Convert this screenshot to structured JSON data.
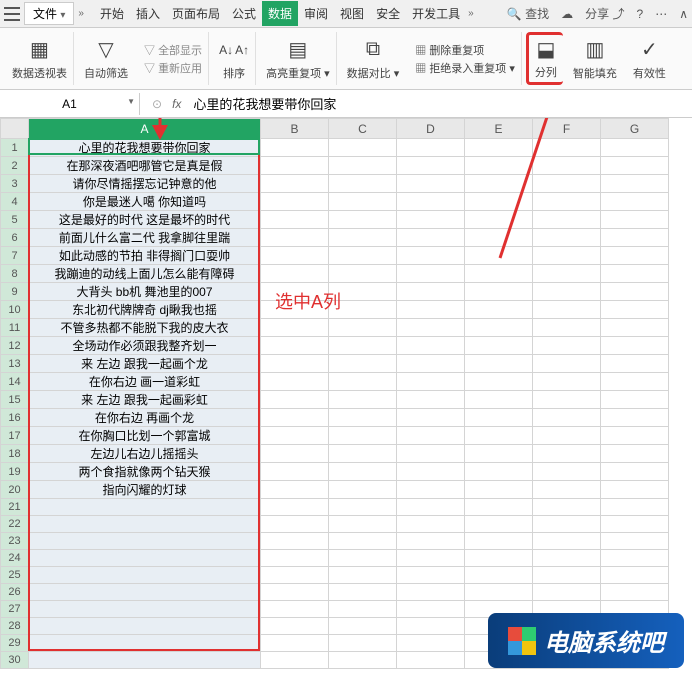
{
  "menubar": {
    "file": "文件",
    "tabs": [
      "开始",
      "插入",
      "页面布局",
      "公式",
      "数据",
      "审阅",
      "视图",
      "安全",
      "开发工具"
    ],
    "active_tab_index": 4,
    "search": "查找",
    "share": "分享"
  },
  "ribbon": {
    "pivot": "数据透视表",
    "filter": "自动筛选",
    "show_all": "全部显示",
    "reapply": "重新应用",
    "sort": "排序",
    "highlight": "高亮重复项",
    "compare": "数据对比",
    "remove_dup": "删除重复项",
    "reject_dup": "拒绝录入重复项",
    "split_col": "分列",
    "smart_fill": "智能填充",
    "validity": "有效性"
  },
  "formula_bar": {
    "name_box": "A1",
    "formula": "心里的花我想要带你回家"
  },
  "columns": [
    "A",
    "B",
    "C",
    "D",
    "E",
    "F",
    "G"
  ],
  "rows_count": 30,
  "data_rows": [
    "心里的花我想要带你回家",
    "在那深夜酒吧哪管它是真是假",
    "请你尽情摇摆忘记钟意的他",
    "你是最迷人噶 你知道吗",
    "这是最好的时代 这是最坏的时代",
    "前面儿什么富二代 我拿脚往里踹",
    "如此动感的节拍 非得搁门口耍帅",
    "我蹦迪的动线上面儿怎么能有障碍",
    "大背头 bb机 舞池里的007",
    "东北初代牌牌奇 dj瞅我也摇",
    "不管多热都不能脱下我的皮大衣",
    "全场动作必须跟我整齐划一",
    "来 左边 跟我一起画个龙",
    "在你右边 画一道彩虹",
    "来 左边 跟我一起画彩虹",
    "在你右边 再画个龙",
    "在你胸口比划一个郭富城",
    "左边儿右边儿摇摇头",
    "两个食指就像两个钻天猴",
    "指向闪耀的灯球"
  ],
  "annotation": "选中A列",
  "watermark": "电脑系统吧"
}
